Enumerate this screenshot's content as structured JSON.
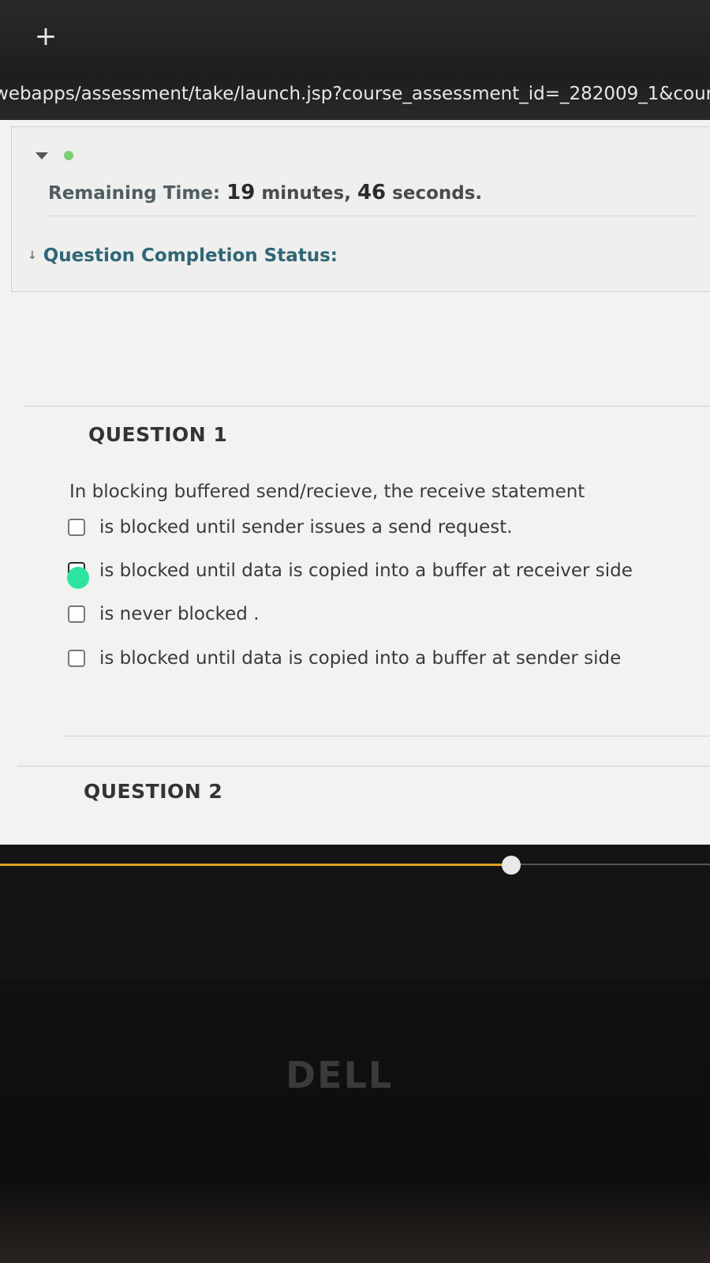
{
  "browser": {
    "new_tab_icon": "plus-icon",
    "url": "webapps/assessment/take/launch.jsp?course_assessment_id=_282009_1&course"
  },
  "timer": {
    "label": "Remaining Time:",
    "minutes": "19",
    "minutes_unit": " minutes, ",
    "seconds": "46",
    "seconds_unit": " seconds."
  },
  "completion": {
    "label": "Question Completion Status:"
  },
  "question1": {
    "heading": "QUESTION 1",
    "text": "In blocking buffered send/recieve, the receive statement",
    "options": [
      {
        "label": "is blocked until sender issues a send request.",
        "checked": false
      },
      {
        "label": "is blocked until data is copied into a buffer at receiver side",
        "checked": true
      },
      {
        "label": "is never blocked .",
        "checked": false
      },
      {
        "label": "is blocked until data is copied into a buffer at sender side",
        "checked": false
      }
    ]
  },
  "question2": {
    "heading": "QUESTION 2"
  },
  "video_progress": {
    "fraction": 0.72,
    "accent": "#e0a320"
  },
  "brand": {
    "logo": "DELL"
  }
}
